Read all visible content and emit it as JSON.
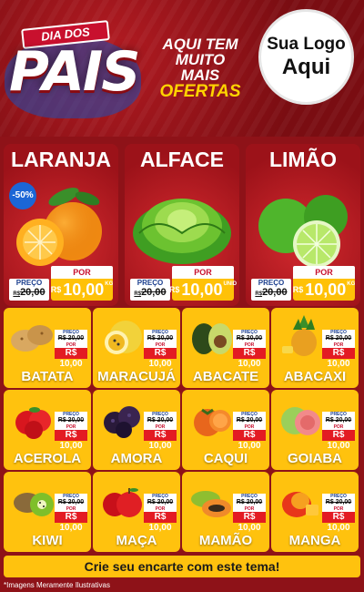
{
  "header": {
    "badge": "DIA DOS",
    "title": "PAIS",
    "promo": [
      "AQUI TEM",
      "MUITO MAIS",
      "OFERTAS"
    ],
    "logo": [
      "Sua Logo",
      "Aqui"
    ]
  },
  "featured": [
    {
      "name": "LARANJA",
      "discount": "-50%",
      "preco_label": "PREÇO",
      "por_label": "POR",
      "old": "20,00",
      "old_cur": "R$",
      "currency": "R$",
      "value": "10,00",
      "unit": "KG"
    },
    {
      "name": "ALFACE",
      "preco_label": "PREÇO",
      "por_label": "POR",
      "old": "20,00",
      "old_cur": "R$",
      "currency": "R$",
      "value": "10,00",
      "unit": "UNID"
    },
    {
      "name": "LIMÃO",
      "preco_label": "PREÇO",
      "por_label": "POR",
      "old": "20,00",
      "old_cur": "R$",
      "currency": "R$",
      "value": "10,00",
      "unit": "KG"
    }
  ],
  "grid": [
    {
      "name": "BATATA",
      "icon": "potato-icon"
    },
    {
      "name": "MARACUJÁ",
      "icon": "passionfruit-icon"
    },
    {
      "name": "ABACATE",
      "icon": "avocado-icon"
    },
    {
      "name": "ABACAXI",
      "icon": "pineapple-icon"
    },
    {
      "name": "ACEROLA",
      "icon": "acerola-icon"
    },
    {
      "name": "AMORA",
      "icon": "blackberry-icon"
    },
    {
      "name": "CAQUI",
      "icon": "persimmon-icon"
    },
    {
      "name": "GOIABA",
      "icon": "guava-icon"
    },
    {
      "name": "KIWI",
      "icon": "kiwi-icon"
    },
    {
      "name": "MAÇA",
      "icon": "apple-icon"
    },
    {
      "name": "MAMÃO",
      "icon": "papaya-icon"
    },
    {
      "name": "MANGA",
      "icon": "mango-icon"
    }
  ],
  "grid_price": {
    "preco_label": "PREÇO",
    "old": "R$ 20,00",
    "por_label": "POR",
    "value": "R$ 10,00"
  },
  "footer": "Crie seu encarte com este tema!",
  "disclaimer": "*Imagens Meramente Ilustrativas",
  "colors": {
    "red": "#c8102e",
    "yellow": "#ffc20e",
    "blue": "#1b66d6"
  }
}
